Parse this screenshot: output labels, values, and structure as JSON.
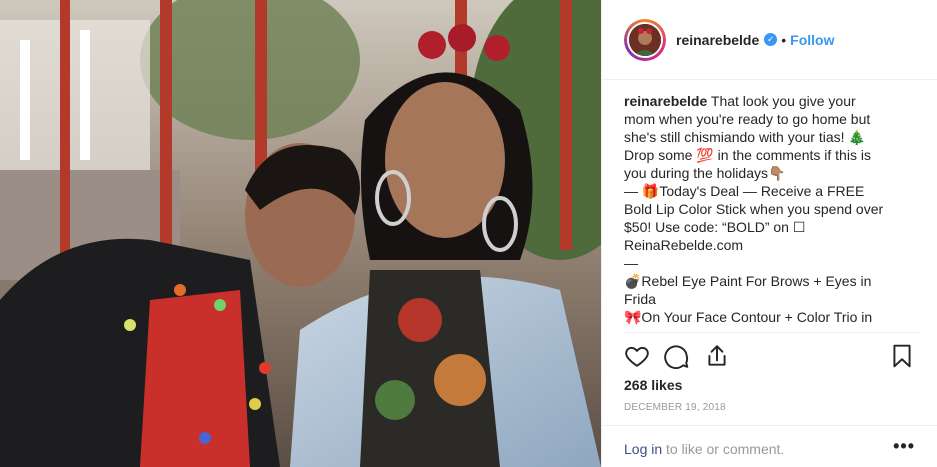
{
  "post": {
    "username": "reinarebelde",
    "verified_icon": "verified-badge-icon",
    "separator": "•",
    "follow_label": "Follow",
    "caption_username": "reinarebelde",
    "caption_lines": [
      "That look you give your",
      "mom when you're ready to go home but",
      "she's still chismiando with your tias! 🎄",
      "Drop some 💯 in the comments if this is",
      "you during the holidays👇🏽",
      "— 🎁Today's Deal — Receive a FREE",
      "Bold Lip Color Stick when you spend over",
      "$50! Use code: “BOLD” on ☐",
      "ReinaRebelde.com",
      "—",
      "💣Rebel Eye Paint For Brows + Eyes in",
      "Frida",
      "🎀On Your Face Contour + Color Trio in"
    ],
    "likes": "268 likes",
    "date": "DECEMBER 19, 2018",
    "login_link": "Log in",
    "login_rest": " to like or comment.",
    "more": "•••"
  },
  "icons": {
    "like": "heart-icon",
    "comment": "comment-icon",
    "share": "share-icon",
    "save": "bookmark-icon"
  },
  "colors": {
    "accent": "#3897f0",
    "text": "#262626",
    "muted": "#999999"
  }
}
